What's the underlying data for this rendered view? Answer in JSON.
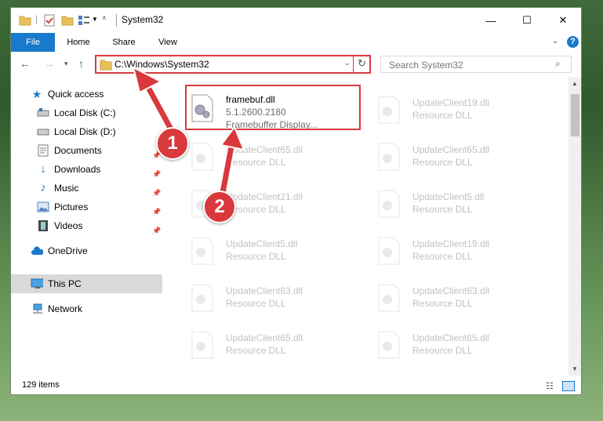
{
  "window": {
    "title": "System32",
    "controls": {
      "minimize": "—",
      "maximize": "☐",
      "close": "✕"
    }
  },
  "ribbon": {
    "tabs": [
      "File",
      "Home",
      "Share",
      "View"
    ],
    "help": "?"
  },
  "address": {
    "path": "C:\\Windows\\System32",
    "search_placeholder": "Search System32"
  },
  "sidebar": {
    "quick_access": "Quick access",
    "items": [
      {
        "label": "Local Disk (C:)"
      },
      {
        "label": "Local Disk (D:)"
      },
      {
        "label": "Documents"
      },
      {
        "label": "Downloads"
      },
      {
        "label": "Music"
      },
      {
        "label": "Pictures"
      },
      {
        "label": "Videos"
      }
    ],
    "onedrive": "OneDrive",
    "this_pc": "This PC",
    "network": "Network"
  },
  "files": {
    "selected": {
      "name": "framebuf.dll",
      "version": "5.1.2600.2180",
      "desc": "Framebuffer Display..."
    },
    "left": [
      {
        "name": "UpdateClient65.dll",
        "type": "Resource DLL"
      },
      {
        "name": "UpdateClient21.dll",
        "type": "Resource DLL"
      },
      {
        "name": "UpdateClient5.dll",
        "type": "Resource DLL"
      },
      {
        "name": "UpdateClient63.dll",
        "type": "Resource DLL"
      },
      {
        "name": "UpdateClient65.dll",
        "type": "Resource DLL"
      }
    ],
    "right": [
      {
        "name": "UpdateClient19.dll",
        "type": "Resource DLL"
      },
      {
        "name": "UpdateClient65.dll",
        "type": "Resource DLL"
      },
      {
        "name": "UpdateClient5.dll",
        "type": "Resource DLL"
      },
      {
        "name": "UpdateClient19.dll",
        "type": "Resource DLL"
      },
      {
        "name": "UpdateClient63.dll",
        "type": "Resource DLL"
      },
      {
        "name": "UpdateClient65.dll",
        "type": "Resource DLL"
      }
    ]
  },
  "status": {
    "count": "129 items"
  },
  "annotations": {
    "step1": "1",
    "step2": "2"
  },
  "colors": {
    "accent": "#1979ca",
    "highlight": "#d9393d"
  }
}
